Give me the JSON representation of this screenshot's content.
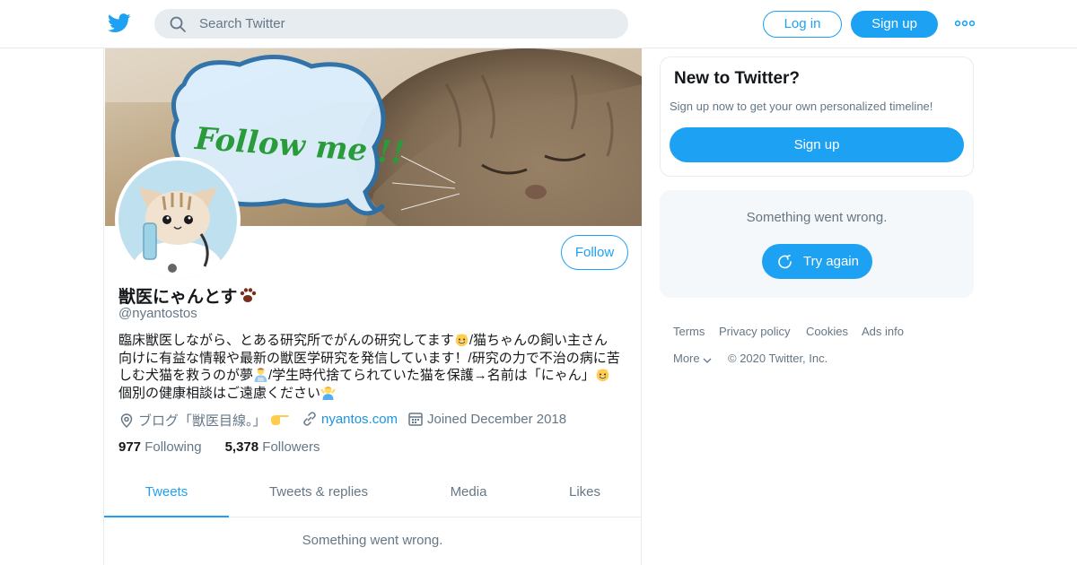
{
  "header": {
    "logo_icon": "twitter-bird-icon",
    "search_placeholder": "Search Twitter",
    "login_label": "Log in",
    "signup_label": "Sign up",
    "more_icon": "more-dots-icon",
    "accent_color": "#1da1f2"
  },
  "profile": {
    "banner_text": "Follow me !!",
    "display_name": "獣医にゃんとす",
    "handle": "@nyantostos",
    "follow_label": "Follow",
    "bio_lines": [
      "臨床獣医しながら、とある研究所でがんの研究してます",
      "/猫ちゃんの飼い主さん",
      "向けに有益な情報や最新の獣医学研究を発信しています！/研究の力で不治の病に苦",
      "しむ犬猫を救うのが夢",
      "/学生時代捨てられていた猫を保護→名前は「にゃん」",
      "個別の健康相談はご遠慮ください"
    ],
    "location": "ブログ「獣医目線。」",
    "website": "nyantos.com",
    "joined": "Joined December 2018",
    "following_count": "977",
    "following_label": "Following",
    "followers_count": "5,378",
    "followers_label": "Followers"
  },
  "tabs": [
    {
      "label": "Tweets",
      "active": true
    },
    {
      "label": "Tweets & replies",
      "active": false
    },
    {
      "label": "Media",
      "active": false
    },
    {
      "label": "Likes",
      "active": false
    }
  ],
  "main_error": "Something went wrong.",
  "sidebar": {
    "new_title": "New to Twitter?",
    "new_sub": "Sign up now to get your own personalized timeline!",
    "new_signup": "Sign up",
    "error_msg": "Something went wrong.",
    "retry_label": "Try again"
  },
  "footer": {
    "links": [
      "Terms",
      "Privacy policy",
      "Cookies",
      "Ads info"
    ],
    "more": "More",
    "copyright": "© 2020 Twitter, Inc."
  }
}
